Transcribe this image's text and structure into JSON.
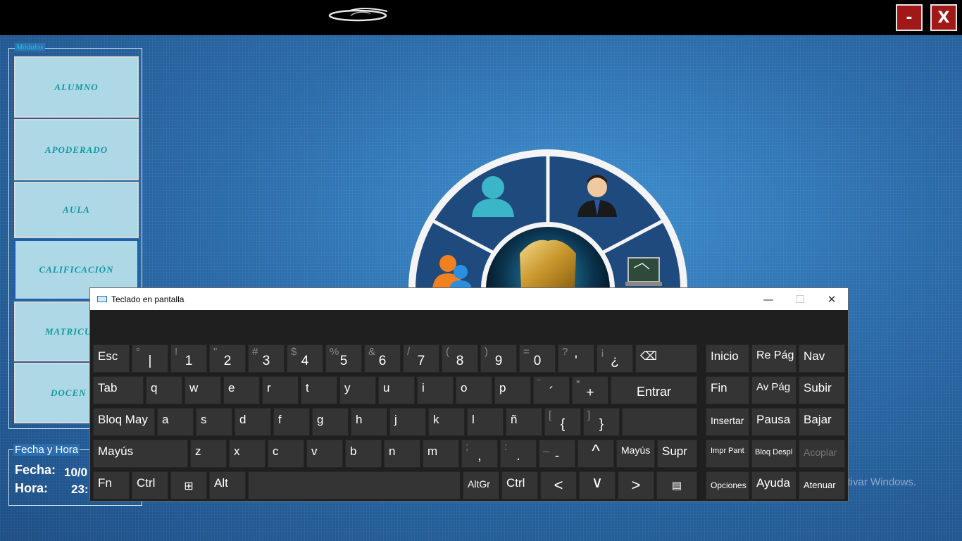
{
  "window_controls": {
    "minimize": "-",
    "close": "X"
  },
  "modules": {
    "legend": "Módulos",
    "items": [
      "ALUMNO",
      "APODERADO",
      "AULA",
      "CALIFICACIÓN",
      "MATRICU",
      "DOCEN"
    ]
  },
  "datetime": {
    "legend": "Fecha y Hora",
    "fecha_label": "Fecha:",
    "fecha_value": "10/0",
    "hora_label": "Hora:",
    "hora_value": "23:"
  },
  "watermark": "ctivar Windows.",
  "keyboard": {
    "title": "Teclado en pantalla",
    "title_buttons": {
      "minimize": "—",
      "maximize": "☐",
      "close": "✕"
    },
    "row1": {
      "esc": "Esc",
      "keys": [
        {
          "shift": "°",
          "char": "|"
        },
        {
          "shift": "!",
          "char": "1"
        },
        {
          "shift": "\"",
          "char": "2"
        },
        {
          "shift": "#",
          "char": "3"
        },
        {
          "shift": "$",
          "char": "4"
        },
        {
          "shift": "%",
          "char": "5"
        },
        {
          "shift": "&",
          "char": "6"
        },
        {
          "shift": "/",
          "char": "7"
        },
        {
          "shift": "(",
          "char": "8"
        },
        {
          "shift": ")",
          "char": "9"
        },
        {
          "shift": "=",
          "char": "0"
        },
        {
          "shift": "?",
          "char": "'"
        },
        {
          "shift": "¡",
          "char": "¿"
        }
      ],
      "backspace": "⌫"
    },
    "row2": {
      "tab": "Tab",
      "keys": [
        "q",
        "w",
        "e",
        "r",
        "t",
        "y",
        "u",
        "i",
        "o",
        "p"
      ],
      "extra": [
        {
          "shift": "¨",
          "char": "´"
        },
        {
          "shift": "*",
          "char": "+"
        }
      ],
      "enter": "Entrar"
    },
    "row3": {
      "caps": "Bloq May",
      "keys": [
        "a",
        "s",
        "d",
        "f",
        "g",
        "h",
        "j",
        "k",
        "l",
        "ñ"
      ],
      "extra": [
        {
          "shift": "[",
          "char": "{"
        },
        {
          "shift": "]",
          "char": "}"
        }
      ]
    },
    "row4": {
      "shift_left": "Mayús",
      "keys": [
        "z",
        "x",
        "c",
        "v",
        "b",
        "n",
        "m"
      ],
      "extra": [
        {
          "shift": ";",
          "char": ","
        },
        {
          "shift": ":",
          "char": "."
        },
        {
          "shift": "_",
          "char": "-"
        }
      ],
      "up": "^",
      "shift_right": "Mayús",
      "supr": "Supr"
    },
    "row5": {
      "fn": "Fn",
      "ctrl": "Ctrl",
      "win": "⊞",
      "alt": "Alt",
      "altgr": "AltGr",
      "ctrl_right": "Ctrl",
      "left": "<",
      "down": "∨",
      "right": ">",
      "menu": "▤"
    },
    "nav": {
      "inicio": "Inicio",
      "repag": "Re Pág",
      "nav": "Nav",
      "fin": "Fin",
      "avpag": "Av Pág",
      "subir": "Subir",
      "insertar": "Insertar",
      "pausa": "Pausa",
      "bajar": "Bajar",
      "imprpant": "Impr Pant",
      "bloqdespl": "Bloq Despl",
      "acoplar": "Acoplar",
      "opciones": "Opciones",
      "ayuda": "Ayuda",
      "atenuar": "Atenuar"
    }
  }
}
